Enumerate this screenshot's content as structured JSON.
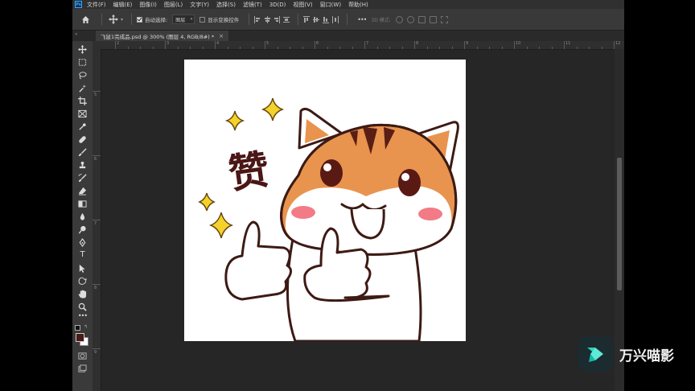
{
  "app": {
    "logo_text": "Ps"
  },
  "menu": [
    "文件(F)",
    "编辑(E)",
    "图像(I)",
    "图层(L)",
    "文字(Y)",
    "选择(S)",
    "滤镜(T)",
    "3D(D)",
    "视图(V)",
    "窗口(W)",
    "帮助(H)"
  ],
  "options": {
    "auto_select_label": "自动选择:",
    "auto_select_value": "图层",
    "show_transform_label": "显示变换控件",
    "mode_3d_label": "3D 模式:",
    "more_label": "•••"
  },
  "document": {
    "tab_title": "飞鼠1完成品.psd @ 300% (图层 4, RGB/8#) *",
    "close_label": "×"
  },
  "rulers": {
    "top": [
      "2",
      "3",
      "4",
      "5",
      "6",
      "7",
      "8",
      "9",
      "10",
      "11",
      "12"
    ],
    "left": [
      "5",
      "6",
      "7",
      "8",
      "9"
    ]
  },
  "toolbar": {
    "more_label": "•••",
    "type_tool_label": "T"
  },
  "canvas_art": {
    "praise_text": "赞"
  },
  "watermark": {
    "text": "万兴喵影"
  },
  "colors": {
    "foreground": "#4a1a14",
    "background": "#ffffff",
    "cat_orange": "#e8944f",
    "outline": "#3d1a14",
    "sparkle": "#f4d22b"
  }
}
